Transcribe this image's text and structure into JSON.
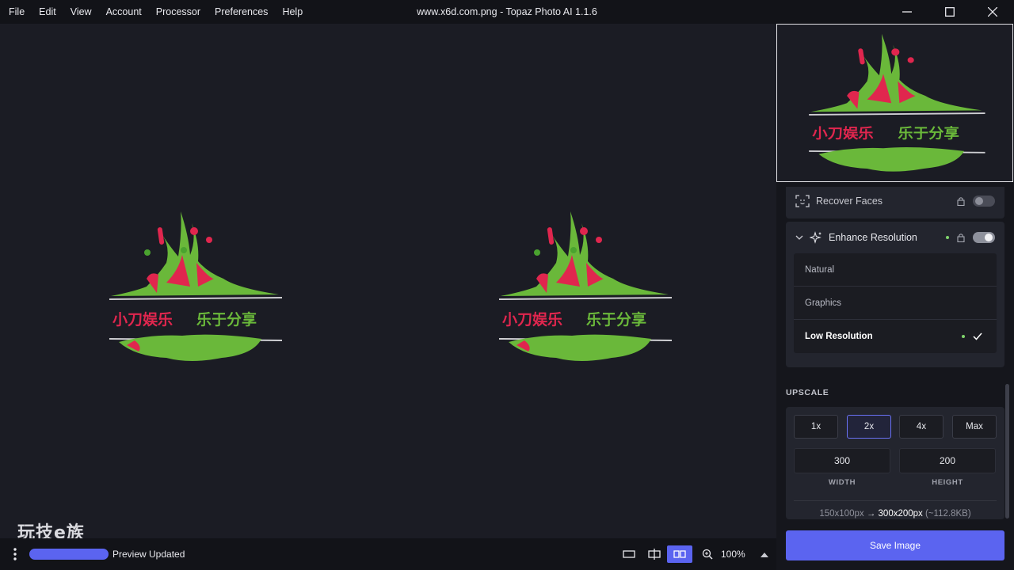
{
  "menu": [
    "File",
    "Edit",
    "View",
    "Account",
    "Processor",
    "Preferences",
    "Help"
  ],
  "window": {
    "title": "www.x6d.com.png - Topaz Photo AI 1.1.6"
  },
  "canvas": {
    "watermark": "玩技e族",
    "image_text": "小刀娱乐 乐于分享"
  },
  "status": {
    "text": "Preview Updated",
    "zoom": "100%",
    "progress": 1.0
  },
  "panel": {
    "recover_faces": {
      "label": "Recover Faces",
      "enabled": false
    },
    "enhance_resolution": {
      "label": "Enhance Resolution",
      "enabled": true,
      "options": [
        "Natural",
        "Graphics",
        "Low Resolution"
      ],
      "selected": "Low Resolution"
    },
    "upscale": {
      "label": "UPSCALE",
      "buttons": [
        "1x",
        "2x",
        "4x",
        "Max"
      ],
      "selected": "2x",
      "width": "300",
      "height": "200",
      "width_label": "WIDTH",
      "height_label": "HEIGHT",
      "from": "150x100px",
      "arrow": "→",
      "to": "300x200px",
      "filesize": "(~112.8KB)"
    },
    "save_label": "Save Image"
  },
  "colors": {
    "accent": "#5b64f0",
    "status_dot": "#7fd36c",
    "paint_green": "#6ab83a",
    "paint_red": "#e0264e"
  }
}
